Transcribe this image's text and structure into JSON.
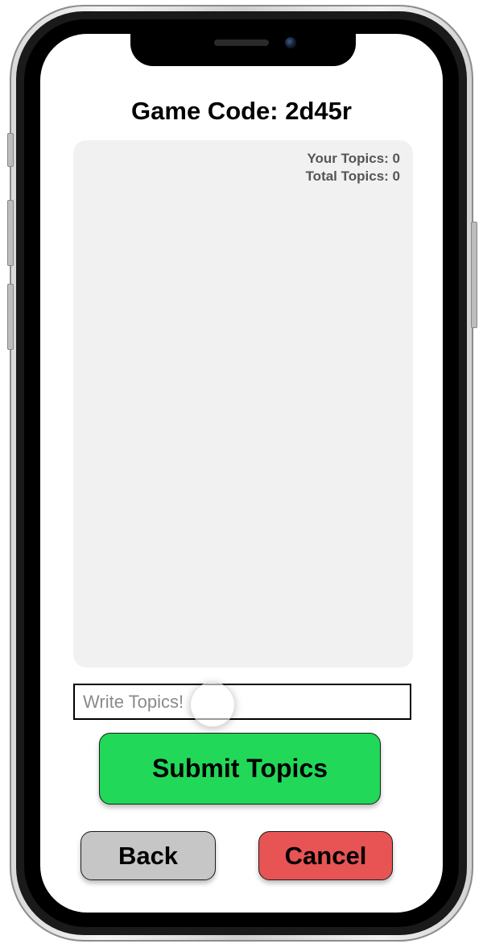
{
  "header": {
    "title": "Game Code: 2d45r"
  },
  "topics_panel": {
    "your_topics": "Your Topics: 0",
    "total_topics": "Total Topics: 0"
  },
  "input": {
    "placeholder": "Write Topics!",
    "value": ""
  },
  "buttons": {
    "submit_label": "Submit Topics",
    "back_label": "Back",
    "cancel_label": "Cancel"
  },
  "colors": {
    "submit": "#22d858",
    "back": "#c6c6c6",
    "cancel": "#e85454",
    "panel": "#f1f1f1"
  }
}
